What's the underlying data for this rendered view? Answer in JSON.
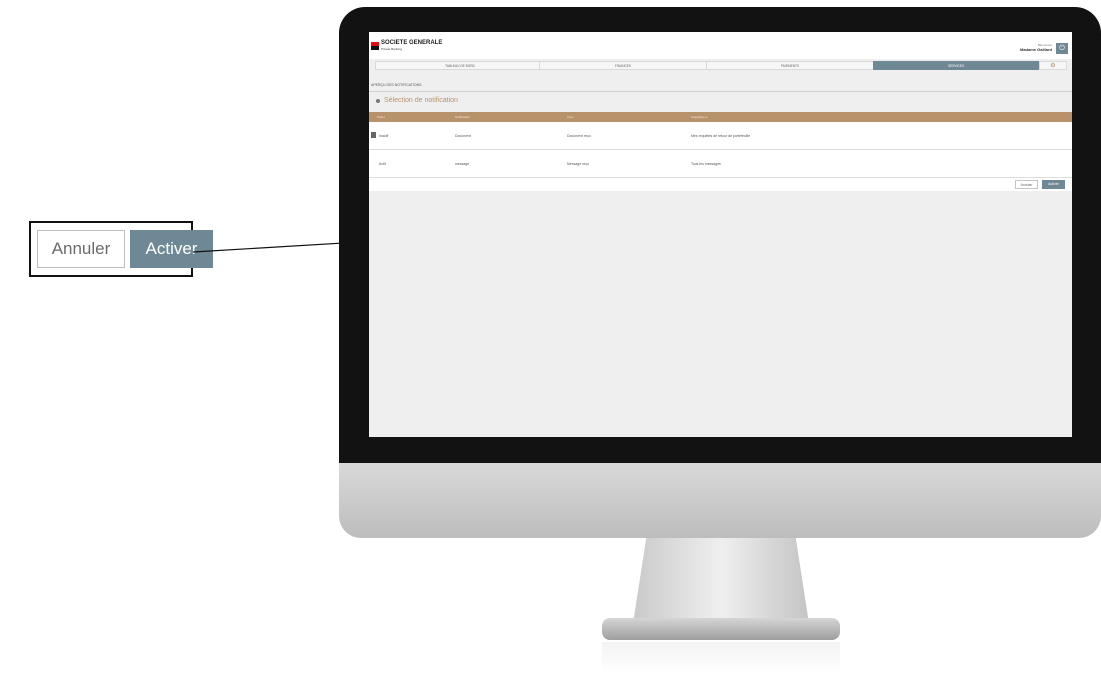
{
  "callout": {
    "cancel_label": "Annuler",
    "activate_label": "Activer"
  },
  "app": {
    "logo_title": "SOCIETE GENERALE",
    "logo_subtitle": "Private Banking",
    "user_greeting": "Bienvenue",
    "user_name": "Madame Gaillard",
    "power_icon": "power-icon"
  },
  "nav": {
    "tabs": [
      {
        "label": "TABLEAU DE BORD"
      },
      {
        "label": "FINANCES"
      },
      {
        "label": "PAIEMENTS"
      },
      {
        "label": "SERVICES"
      },
      {
        "label": "⚙"
      }
    ],
    "active_tab": "SERVICES"
  },
  "breadcrumb": "APERÇU DES NOTIFICATIONS",
  "section_title": "Sélection de notification",
  "table": {
    "columns": [
      "Statut",
      "Notification",
      "Type",
      "S'applique à"
    ],
    "rows": [
      {
        "status": "Inactif",
        "notification": "Document",
        "type": "Document reçu",
        "applies_to": "Mes requêtes de retour de portefeuille"
      },
      {
        "status": "Actif",
        "notification": "message",
        "type": "Message reçu",
        "applies_to": "Tous les messages"
      }
    ]
  },
  "actions": {
    "cancel_label": "Annuler",
    "activate_label": "Activer"
  },
  "colors": {
    "accent": "#6f8895",
    "table_header": "#b8926b",
    "brand_red": "#e30613"
  }
}
